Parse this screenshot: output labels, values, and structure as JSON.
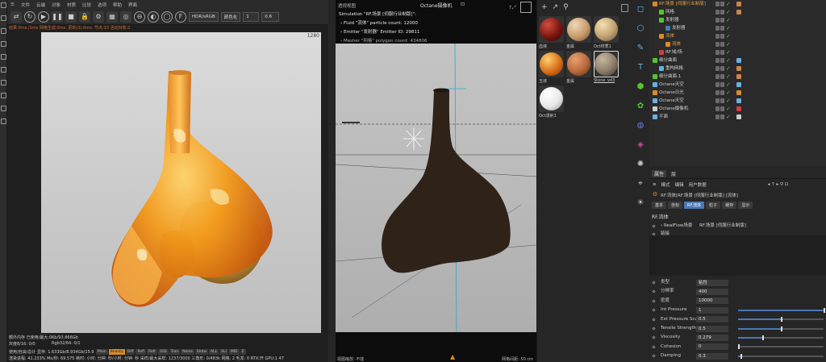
{
  "octane": {
    "menu": [
      "文件",
      "云端",
      "对象",
      "材质",
      "比较",
      "选项",
      "帮助",
      "界面"
    ],
    "colorspace": "HDR/sRGB",
    "tonemap": "颜色化",
    "frame": "1",
    "exposure": "0.6",
    "status": "结果:0ms./1ms  网格生成:0ms. 更新(3):0ms. 节点:33 活动对象:2",
    "render_size": "1280",
    "bottom_line1": "额外内存 已使用/最大:0Kb/93.866Gb",
    "bottom_line2": "灰度8/16: 0/0",
    "bottom_rgb": "Rgb32/64: 0/1",
    "bottom_line3": "使用/自由/总计 显存: 1.633Gb/8.934Gb/15.9",
    "bottom_line4": "渲染进程: 41.233%  Ms/秒: 69.575  耗时: 小时: 分钟: 秒/小时: 分钟: 秒  采样/最大采样: 1237/3000  三角形: 0/483k  网格: 2  毛发: 0  RTX:开  GPU:1  47",
    "tabs": [
      "Main",
      "Beauty",
      "Diff",
      "Refl",
      "Refr",
      "SSS",
      "Tran",
      "Noise",
      "Shdw",
      "ALL",
      "SLI",
      "MID",
      "Z"
    ]
  },
  "viewport": {
    "title": "Octane摄像机",
    "mode": "透视视图",
    "sim": "Simulation \"RF.场景 [伺服行业制版]\":",
    "fluid": "Fluid \"流体\" particle count: 12000",
    "emitter": "Emitter \"发射器\" Emitter ID: 29811",
    "mesher": "Mesher \"网格\" polygon count: 434806",
    "footer_left": "视图缩放: 不能",
    "footer_right": "网格间距: 50 cm"
  },
  "materials": [
    {
      "label": "血液",
      "color": "#7a1510"
    },
    {
      "label": "金属",
      "color": "#c89a6a"
    },
    {
      "label": "Oct材质1",
      "color": "#c0a070"
    },
    {
      "label": "玉液",
      "color": "#d8701a"
    },
    {
      "label": "金属",
      "color": "#b8683a"
    },
    {
      "label": "Stone_vd3",
      "color": "#8a7a68"
    },
    {
      "label": "Oct漫射1",
      "color": "#e8e8e8"
    }
  ],
  "objects": [
    {
      "name": "RF.场景 [伺服行业制版]",
      "indent": 0,
      "color": "#d98b2b",
      "tagc": "#c9864a"
    },
    {
      "name": "网格",
      "indent": 8,
      "color": "#57c42f",
      "tagc": "#c9864a"
    },
    {
      "name": "发射器",
      "indent": 8,
      "color": "#57c42f",
      "tagc": ""
    },
    {
      "name": "发射器",
      "indent": 16,
      "color": "#4a78b5",
      "tagc": ""
    },
    {
      "name": "流体",
      "indent": 8,
      "color": "#d98b2b",
      "tagc": ""
    },
    {
      "name": "流体",
      "indent": 16,
      "color": "#d98b2b",
      "tagc": ""
    },
    {
      "name": "RF.域/场",
      "indent": 8,
      "color": "#d04040",
      "tagc": ""
    },
    {
      "name": "细分曲面",
      "indent": 0,
      "color": "#57c42f",
      "tagc": "#6ab0e0"
    },
    {
      "name": "重构网格",
      "indent": 8,
      "color": "#6ab0e0",
      "tagc": "#c9864a"
    },
    {
      "name": "细分曲面.1",
      "indent": 0,
      "color": "#57c42f",
      "tagc": "#c9864a"
    },
    {
      "name": "Octane天空",
      "indent": 0,
      "color": "#6ab0e0",
      "tagc": "#6ab0e0"
    },
    {
      "name": "Octane日光",
      "indent": 0,
      "color": "#d98b2b",
      "tagc": "#d98b2b"
    },
    {
      "name": "Octane天空",
      "indent": 0,
      "color": "#6ab0e0",
      "tagc": "#6ab0e0"
    },
    {
      "name": "Octane摄像机",
      "indent": 0,
      "color": "#cccccc",
      "tagc": "#d04040"
    },
    {
      "name": "平面",
      "indent": 0,
      "color": "#6ab0e0",
      "tagc": "#cccccc"
    }
  ],
  "attributes": {
    "tabs": [
      "属性",
      "层"
    ],
    "menu": [
      "模式",
      "编辑",
      "用户数据"
    ],
    "path": "RF.流体[RF.场景 [伺服行业制版] [流体]",
    "subtabs": [
      "基本",
      "坐标",
      "RF.流体",
      "粒子",
      "缓存",
      "显示"
    ],
    "active_subtab": "RF.流体",
    "section": "RF.流体",
    "scene_label": "RealFlow场景",
    "scene_value": "RF.场景 [伺服行业制版]",
    "link_label": "链接",
    "params": [
      {
        "label": "类型",
        "value": "粘性",
        "slider": null
      },
      {
        "label": "分辨率",
        "value": "400",
        "slider": null
      },
      {
        "label": "密度",
        "value": "10000",
        "slider": null
      },
      {
        "label": "Int Pressure",
        "value": "1",
        "slider": 1.0
      },
      {
        "label": "Ext Pressure Scale",
        "value": "0.5",
        "slider": 0.5
      },
      {
        "label": "Tensile Strength",
        "value": "0.5",
        "slider": 0.5
      },
      {
        "label": "Viscosity",
        "value": "0.279",
        "slider": 0.279
      },
      {
        "label": "Cohesion",
        "value": "0",
        "slider": 0
      },
      {
        "label": "Damping",
        "value": "0.3",
        "slider": 0.03
      }
    ]
  }
}
